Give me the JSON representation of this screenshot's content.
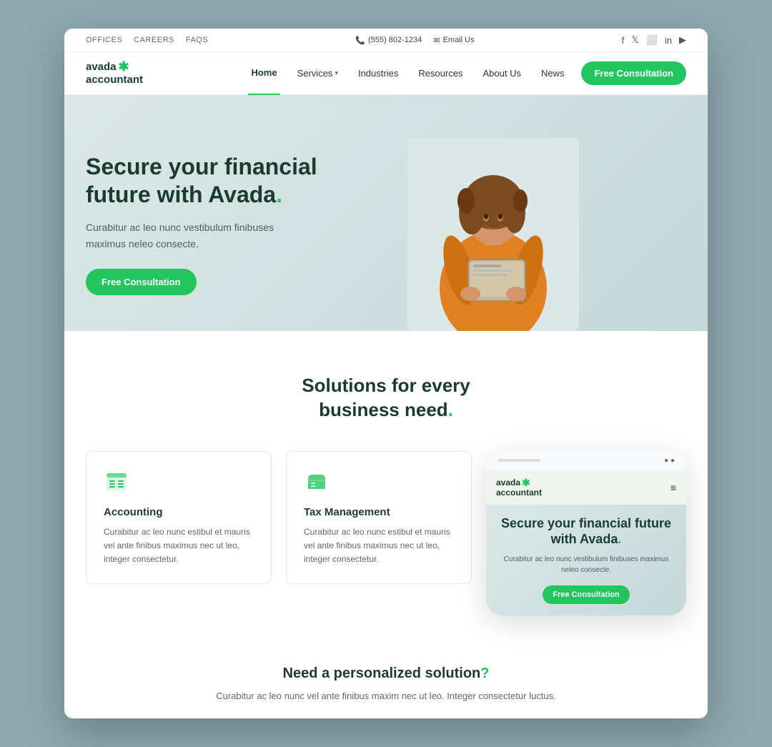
{
  "colors": {
    "green": "#22c55e",
    "dark": "#1a3c2e",
    "bg": "#8fa8b0"
  },
  "topbar": {
    "links": [
      "OFFICES",
      "CAREERS",
      "FAQS"
    ],
    "phone": "(555) 802-1234",
    "email": "Email Us",
    "socials": [
      "f",
      "t",
      "in",
      "li",
      "yt"
    ]
  },
  "logo": {
    "top": "avada",
    "bottom": "accountant",
    "asterisk": "✱"
  },
  "nav": {
    "items": [
      {
        "label": "Home",
        "active": true,
        "hasDropdown": false
      },
      {
        "label": "Services",
        "active": false,
        "hasDropdown": true
      },
      {
        "label": "Industries",
        "active": false,
        "hasDropdown": false
      },
      {
        "label": "Resources",
        "active": false,
        "hasDropdown": false
      },
      {
        "label": "About Us",
        "active": false,
        "hasDropdown": false
      },
      {
        "label": "News",
        "active": false,
        "hasDropdown": false
      }
    ],
    "cta": "Free Consultation"
  },
  "hero": {
    "title_line1": "Secure your financial",
    "title_line2": "future with Avada",
    "title_dot": ".",
    "subtitle": "Curabitur ac leo nunc vestibulum finibuses maximus neleo consecte.",
    "cta": "Free Consultation"
  },
  "solutions": {
    "title_line1": "Solutions for every",
    "title_line2": "business need",
    "title_dot": ".",
    "cards": [
      {
        "icon": "accounting",
        "title": "Accounting",
        "desc": "Curabitur ac leo nunc estibul et mauris vel ante finibus maximus nec ut leo, integer consectetur."
      },
      {
        "icon": "folder",
        "title": "Tax Management",
        "desc": "Curabitur ac leo nunc estibul et mauris vel ante finibus maximus nec ut leo, integer consectetur."
      }
    ]
  },
  "mobile": {
    "logo_top": "avada",
    "logo_asterisk": "✱",
    "logo_bottom": "accountant",
    "hero_title": "Secure your financial future with Avada",
    "hero_dot": ".",
    "hero_sub": "Curabitur ac leo nunc vestibulum finibuses maximus neleo consecte.",
    "cta": "Free Consultation"
  },
  "bottom": {
    "title": "Need a personalized solution",
    "title_dot": "?",
    "desc": "Curabitur ac leo nunc vel ante finibus maxim nec ut leo. Integer consectetur luctus."
  }
}
